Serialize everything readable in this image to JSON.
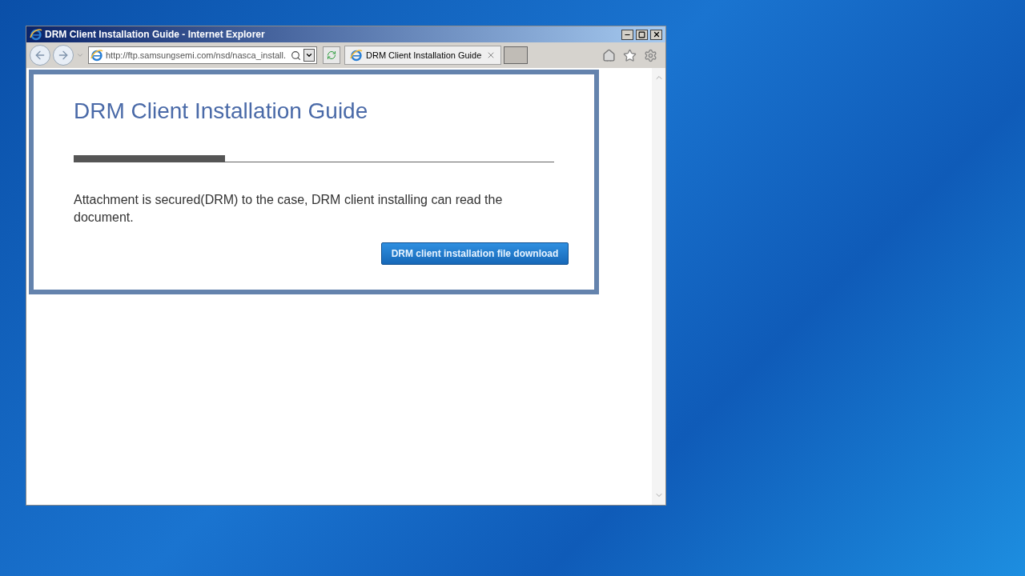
{
  "window": {
    "title": "DRM Client Installation Guide - Internet Explorer"
  },
  "address_bar": {
    "value": "http://ftp.samsungsemi.com/nsd/nasca_install."
  },
  "tabs": [
    {
      "label": "DRM Client Installation Guide",
      "selected": true
    }
  ],
  "page": {
    "heading": "DRM Client Installation Guide",
    "message": "Attachment is secured(DRM) to the case, DRM client installing can read the document.",
    "button": "DRM client installation file download"
  }
}
